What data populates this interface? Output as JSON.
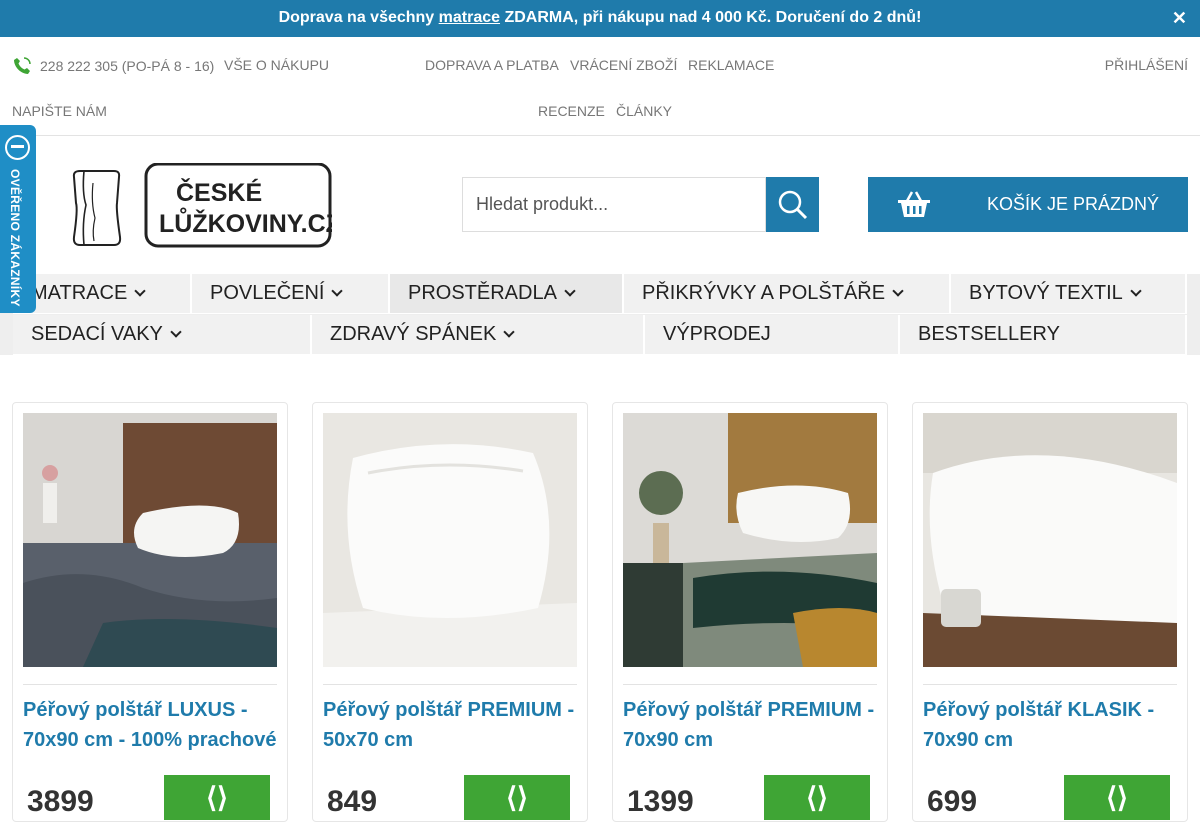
{
  "banner": {
    "text_before": "Doprava na všechny ",
    "link": "matrace",
    "text_after": " ZDARMA, při nákupu nad 4 000 Kč. Doručení do 2 dnů!",
    "close": "✕"
  },
  "topbar": {
    "phone": "228 222 305 (PO-PÁ 8 - 16)",
    "links": [
      "VŠE O NÁKUPU",
      "DOPRAVA A PLATBA",
      "VRÁCENÍ ZBOŽÍ",
      "REKLAMACE",
      "PŘIHLÁŠENÍ",
      "NAPIŠTE NÁM",
      "RECENZE",
      "ČLÁNKY"
    ]
  },
  "badge": {
    "text": "OVĚŘENO ZÁKAZNÍKY"
  },
  "logo": {
    "line1": "ČESKÉ",
    "line2": "LŮŽKOVINY.CZ"
  },
  "search": {
    "placeholder": "Hledat produkt..."
  },
  "cart": {
    "label": "KOŠÍK JE PRÁZDNÝ"
  },
  "nav": {
    "row1": [
      "MATRACE",
      "POVLEČENÍ",
      "PROSTĚRADLA",
      "PŘIKRÝVKY A POLŠTÁŘE",
      "BYTOVÝ TEXTIL"
    ],
    "row2": [
      "SEDACÍ VAKY",
      "ZDRAVÝ SPÁNEK",
      "VÝPRODEJ",
      "BESTSELLERY"
    ]
  },
  "products": [
    {
      "title": "Péřový polštář LUXUS - 70x90 cm - 100% prachové",
      "price": "3899",
      "buy": "⟨⟩"
    },
    {
      "title": "Péřový polštář PREMIUM - 50x70 cm",
      "price": "849",
      "buy": "⟨⟩"
    },
    {
      "title": "Péřový polštář PREMIUM - 70x90 cm",
      "price": "1399",
      "buy": "⟨⟩"
    },
    {
      "title": "Péřový polštář KLASIK - 70x90 cm",
      "price": "699",
      "buy": "⟨⟩"
    }
  ],
  "colors": {
    "brand": "#1f7bab",
    "buy": "#3fa535"
  }
}
